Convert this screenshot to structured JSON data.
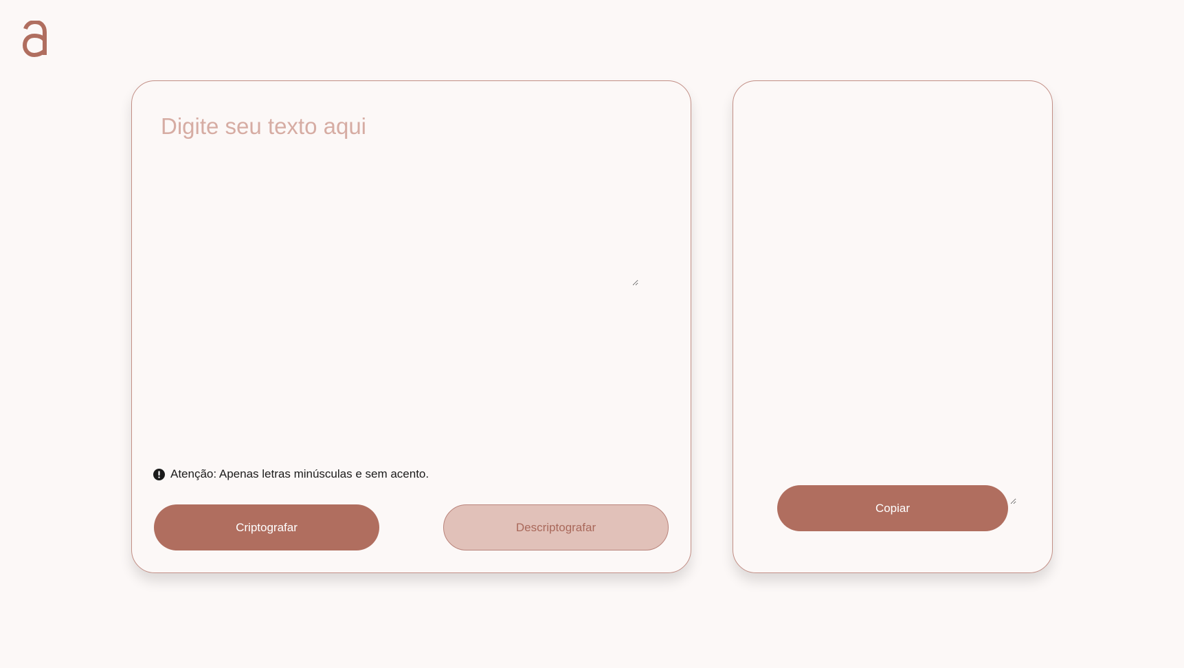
{
  "logo": {
    "icon": "logo-a-icon",
    "color": "#b06e5f"
  },
  "input_panel": {
    "placeholder": "Digite seu texto aqui",
    "value": "",
    "warning": {
      "icon": "exclamation-circle-icon",
      "text": "Atenção: Apenas letras minúsculas e sem acento."
    },
    "encrypt_label": "Criptografar",
    "decrypt_label": "Descriptografar"
  },
  "output_panel": {
    "value": "",
    "copy_label": "Copiar"
  },
  "colors": {
    "background": "#fcf8f7",
    "accent": "#b06e5f",
    "accent_light": "#e1c1b9",
    "border": "#c28e85",
    "placeholder": "#d6aca3"
  }
}
